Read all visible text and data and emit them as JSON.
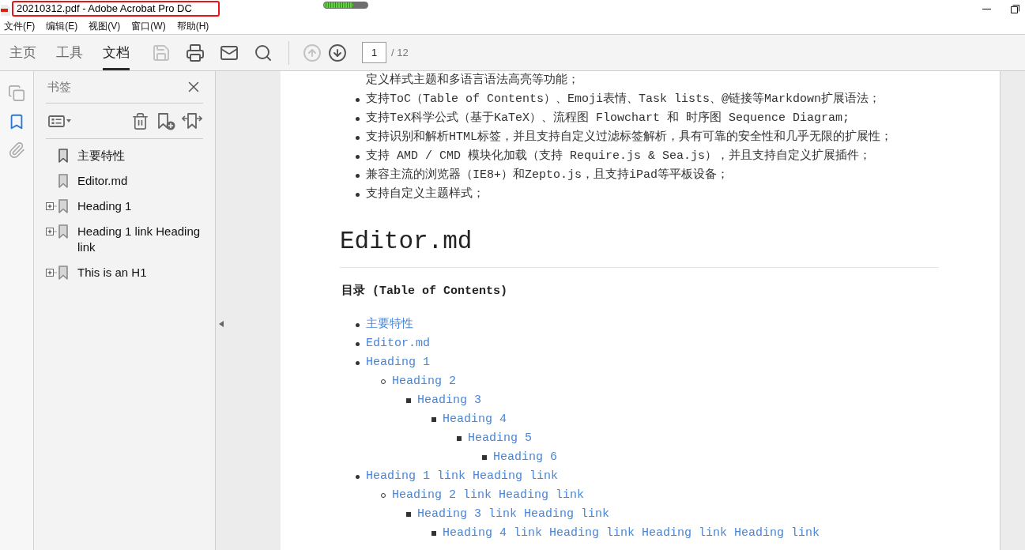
{
  "window": {
    "title": "20210312.pdf - Adobe Acrobat Pro DC",
    "title_marked": true,
    "progress": {
      "level": 0.68
    }
  },
  "menu": [
    "文件(F)",
    "编辑(E)",
    "视图(V)",
    "窗口(W)",
    "帮助(H)"
  ],
  "tabs": [
    {
      "label": "主页",
      "selected": false
    },
    {
      "label": "工具",
      "selected": false
    },
    {
      "label": "文档",
      "selected": true
    }
  ],
  "toolbar": {
    "save": {
      "disabled": true
    },
    "print": {
      "disabled": false
    },
    "email": {
      "disabled": false
    },
    "search": {
      "disabled": false
    },
    "previous_page": {
      "disabled": true
    },
    "next_page": {
      "disabled": false
    },
    "page_field": {
      "value": "1"
    },
    "page_count": "/ 12"
  },
  "nav_rail": [
    {
      "selected": false
    },
    {
      "selected": true
    },
    {
      "selected": false
    }
  ],
  "bookmarks_panel": {
    "title": "书签",
    "items": [
      {
        "label": "主要特性"
      },
      {
        "label": "Editor.md"
      },
      {
        "label": "Heading 1",
        "expanded": false
      },
      {
        "label": "Heading 1 link Heading link",
        "expanded": false
      },
      {
        "label": "This is an H1",
        "expanded": false
      }
    ]
  },
  "document": {
    "continued_text": "定义样式主题和多语言语法高亮等功能；",
    "features": [
      "支持ToC（Table of Contents）、Emoji表情、Task lists、@链接等Markdown扩展语法；",
      "支持TeX科学公式（基于KaTeX）、流程图 Flowchart 和 时序图 Sequence Diagram;",
      "支持识别和解析HTML标签，并且支持自定义过滤标签解析，具有可靠的安全性和几乎无限的扩展性；",
      "支持 AMD / CMD 模块化加载（支持 Require.js & Sea.js），并且支持自定义扩展插件；",
      "兼容主流的浏览器（IE8+）和Zepto.js，且支持iPad等平板设备；",
      "支持自定义主题样式；"
    ],
    "heading": "Editor.md",
    "toc_title": "目录 (Table of Contents)",
    "toc": [
      {
        "text": "主要特性"
      },
      {
        "text": "Editor.md"
      },
      {
        "text": "Heading 1",
        "children": [
          {
            "text": "Heading 2",
            "children": [
              {
                "text": "Heading 3",
                "children": [
                  {
                    "text": "Heading 4",
                    "children": [
                      {
                        "text": "Heading 5",
                        "children": [
                          {
                            "text": "Heading 6"
                          }
                        ]
                      }
                    ]
                  }
                ]
              }
            ]
          }
        ]
      },
      {
        "text": "Heading 1 link Heading link",
        "children": [
          {
            "text": "Heading 2 link Heading link",
            "children": [
              {
                "text": "Heading 3 link Heading link",
                "children": [
                  {
                    "text": "Heading 4 link Heading link Heading link Heading link"
                  }
                ]
              }
            ]
          }
        ]
      }
    ]
  }
}
